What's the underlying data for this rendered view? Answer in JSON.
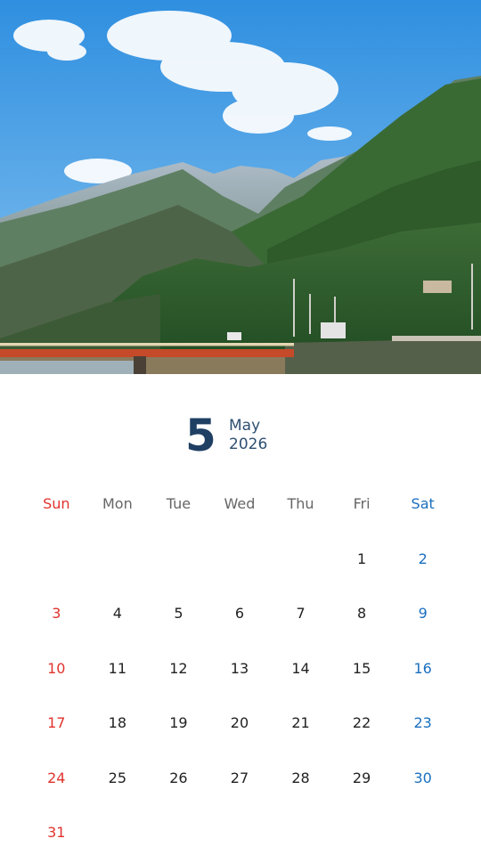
{
  "calendar": {
    "month_number": "5",
    "month_name": "May",
    "year": "2026",
    "weekdays": [
      "Sun",
      "Mon",
      "Tue",
      "Wed",
      "Thu",
      "Fri",
      "Sat"
    ],
    "weeks": [
      [
        "",
        "",
        "",
        "",
        "",
        "1",
        "2"
      ],
      [
        "3",
        "4",
        "5",
        "6",
        "7",
        "8",
        "9"
      ],
      [
        "10",
        "11",
        "12",
        "13",
        "14",
        "15",
        "16"
      ],
      [
        "17",
        "18",
        "19",
        "20",
        "21",
        "22",
        "23"
      ],
      [
        "24",
        "25",
        "26",
        "27",
        "28",
        "29",
        "30"
      ],
      [
        "31",
        "",
        "",
        "",
        "",
        "",
        ""
      ]
    ]
  },
  "colors": {
    "sunday": "#e0332e",
    "saturday": "#1a6fbf",
    "title": "#1f3f63"
  }
}
